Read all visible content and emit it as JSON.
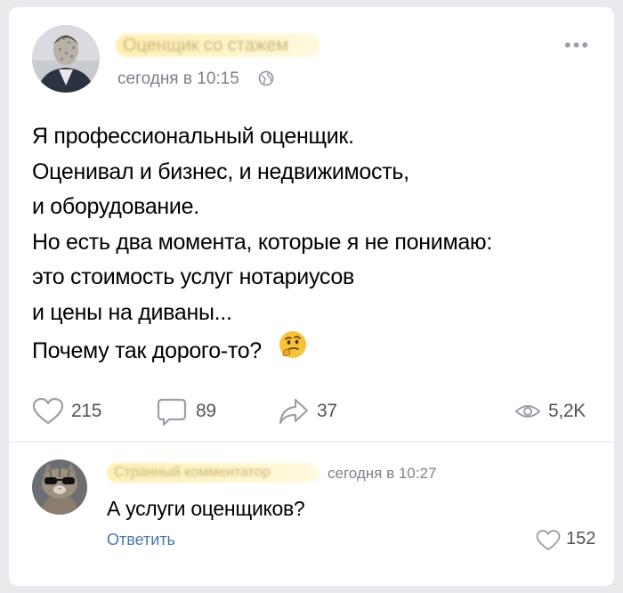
{
  "post": {
    "author_name": "Оценщик со стажем",
    "time": "сегодня в 10:15",
    "text_lines": [
      "Я профессиональный оценщик.",
      "Оценивал и бизнес, и недвижимость,",
      "и оборудование.",
      "Но есть два момента, которые я не понимаю:",
      "это стоимость услуг нотариусов",
      "и цены на диваны..."
    ],
    "question": "Почему так дорого-то?",
    "emoji": "thinking-face"
  },
  "actions": {
    "likes": "215",
    "comments": "89",
    "shares": "37",
    "views": "5,2K"
  },
  "comment": {
    "author_name": "Странный комментатор",
    "time": "сегодня в 10:27",
    "text": "А услуги оценщиков?",
    "reply_label": "Ответить",
    "likes": "152"
  },
  "colors": {
    "link": "#4a76a8",
    "secondary": "#7c8188",
    "icon": "#9aa0a7"
  },
  "icons": [
    "globe-icon",
    "more-icon",
    "heart-icon",
    "comment-icon",
    "share-icon",
    "eye-icon"
  ]
}
